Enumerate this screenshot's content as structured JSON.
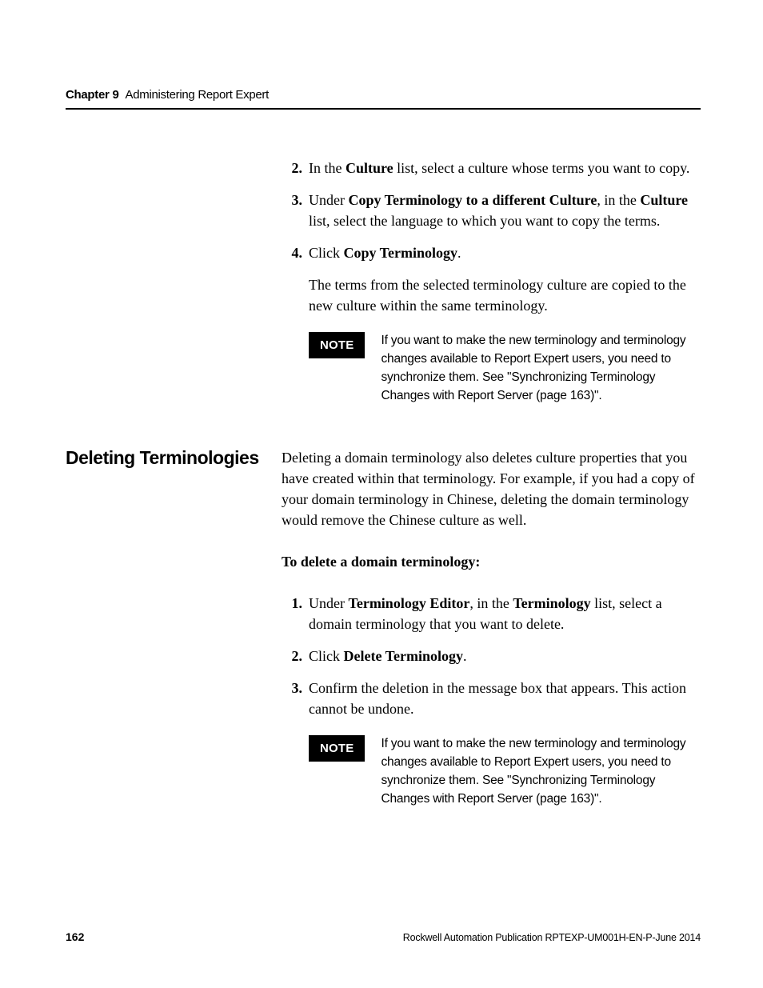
{
  "header": {
    "chapter_label": "Chapter 9",
    "chapter_title": "Administering Report Expert"
  },
  "section1": {
    "steps": {
      "s2": {
        "pre": "In the ",
        "b1": "Culture",
        "post": " list, select a culture whose terms you want to copy."
      },
      "s3": {
        "pre": "Under ",
        "b1": "Copy Terminology to a different Culture",
        "mid": ", in the ",
        "b2": "Culture",
        "post": " list, select the language to which you want to copy the terms."
      },
      "s4": {
        "pre": "Click ",
        "b1": "Copy Terminology",
        "post": "."
      }
    },
    "sub_para": "The terms from the selected terminology culture are copied to the new culture within the same terminology.",
    "note": {
      "badge": "NOTE",
      "text": "If you want to make the new terminology and terminology changes available to Report Expert users, you need to synchronize them. See \"Synchronizing Terminology Changes with Report Server (page 163)\"."
    }
  },
  "section2": {
    "heading": "Deleting Terminologies",
    "intro": "Deleting a domain terminology also deletes culture properties that you have created within that terminology. For example, if you had a copy of your domain terminology in Chinese, deleting the domain terminology would remove the Chinese culture as well.",
    "proc_heading": "To delete a domain terminology:",
    "steps": {
      "s1": {
        "pre": "Under ",
        "b1": "Terminology Editor",
        "mid": ", in the ",
        "b2": "Terminology",
        "post": " list, select a domain terminology that you want to delete."
      },
      "s2": {
        "pre": "Click ",
        "b1": "Delete Terminology",
        "post": "."
      },
      "s3": {
        "text": "Confirm the deletion in the message box that appears. This action cannot be undone."
      }
    },
    "note": {
      "badge": "NOTE",
      "text": "If you want to make the new terminology and terminology changes available to Report Expert users, you need to synchronize them. See \"Synchronizing Terminology Changes with Report Server (page 163)\"."
    }
  },
  "footer": {
    "page_number": "162",
    "publication": "Rockwell Automation Publication RPTEXP-UM001H-EN-P-June 2014"
  }
}
